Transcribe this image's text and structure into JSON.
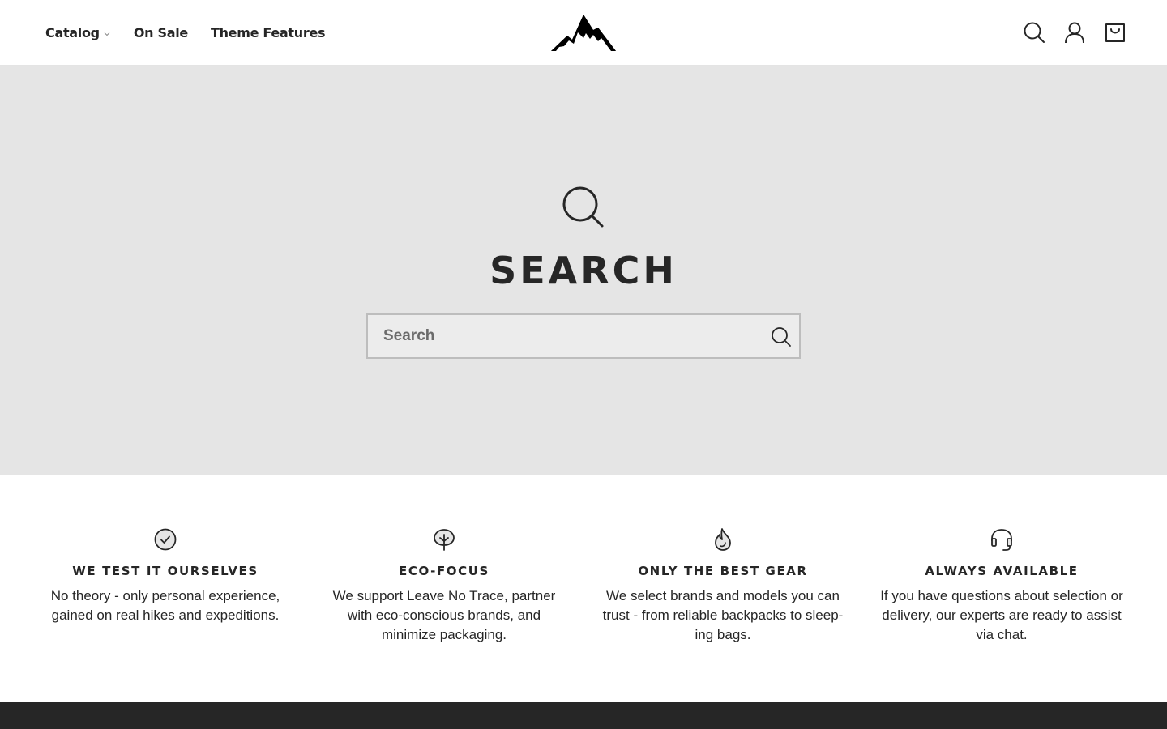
{
  "header": {
    "nav": [
      {
        "label": "Catalog",
        "has_dropdown": true
      },
      {
        "label": "On Sale"
      },
      {
        "label": "Theme Features"
      }
    ],
    "icons": [
      "search-icon",
      "account-icon",
      "cart-icon"
    ]
  },
  "hero": {
    "title": "SEARCH",
    "search": {
      "placeholder": "Search",
      "value": ""
    }
  },
  "features": [
    {
      "icon": "check-circle-icon",
      "title": "WE TEST IT OURSELVES",
      "text": "No theory - only personal experience, gained on real hikes and expeditions."
    },
    {
      "icon": "tree-icon",
      "title": "ECO-FOCUS",
      "text": "We support Leave No Trace, partner with eco-conscious brands, and minimize packaging."
    },
    {
      "icon": "flame-icon",
      "title": "ONLY THE BEST GEAR",
      "text": "We select brands and models you can trust - from reliable backpacks to sleep-ing bags."
    },
    {
      "icon": "headset-icon",
      "title": "ALWAYS AVAILABLE",
      "text": "If you have questions about selection or delivery, our experts are ready to assist via chat."
    }
  ],
  "colors": {
    "text": "#262626",
    "hero_bg": "#e5e5e5",
    "footer_bg": "#262626"
  }
}
